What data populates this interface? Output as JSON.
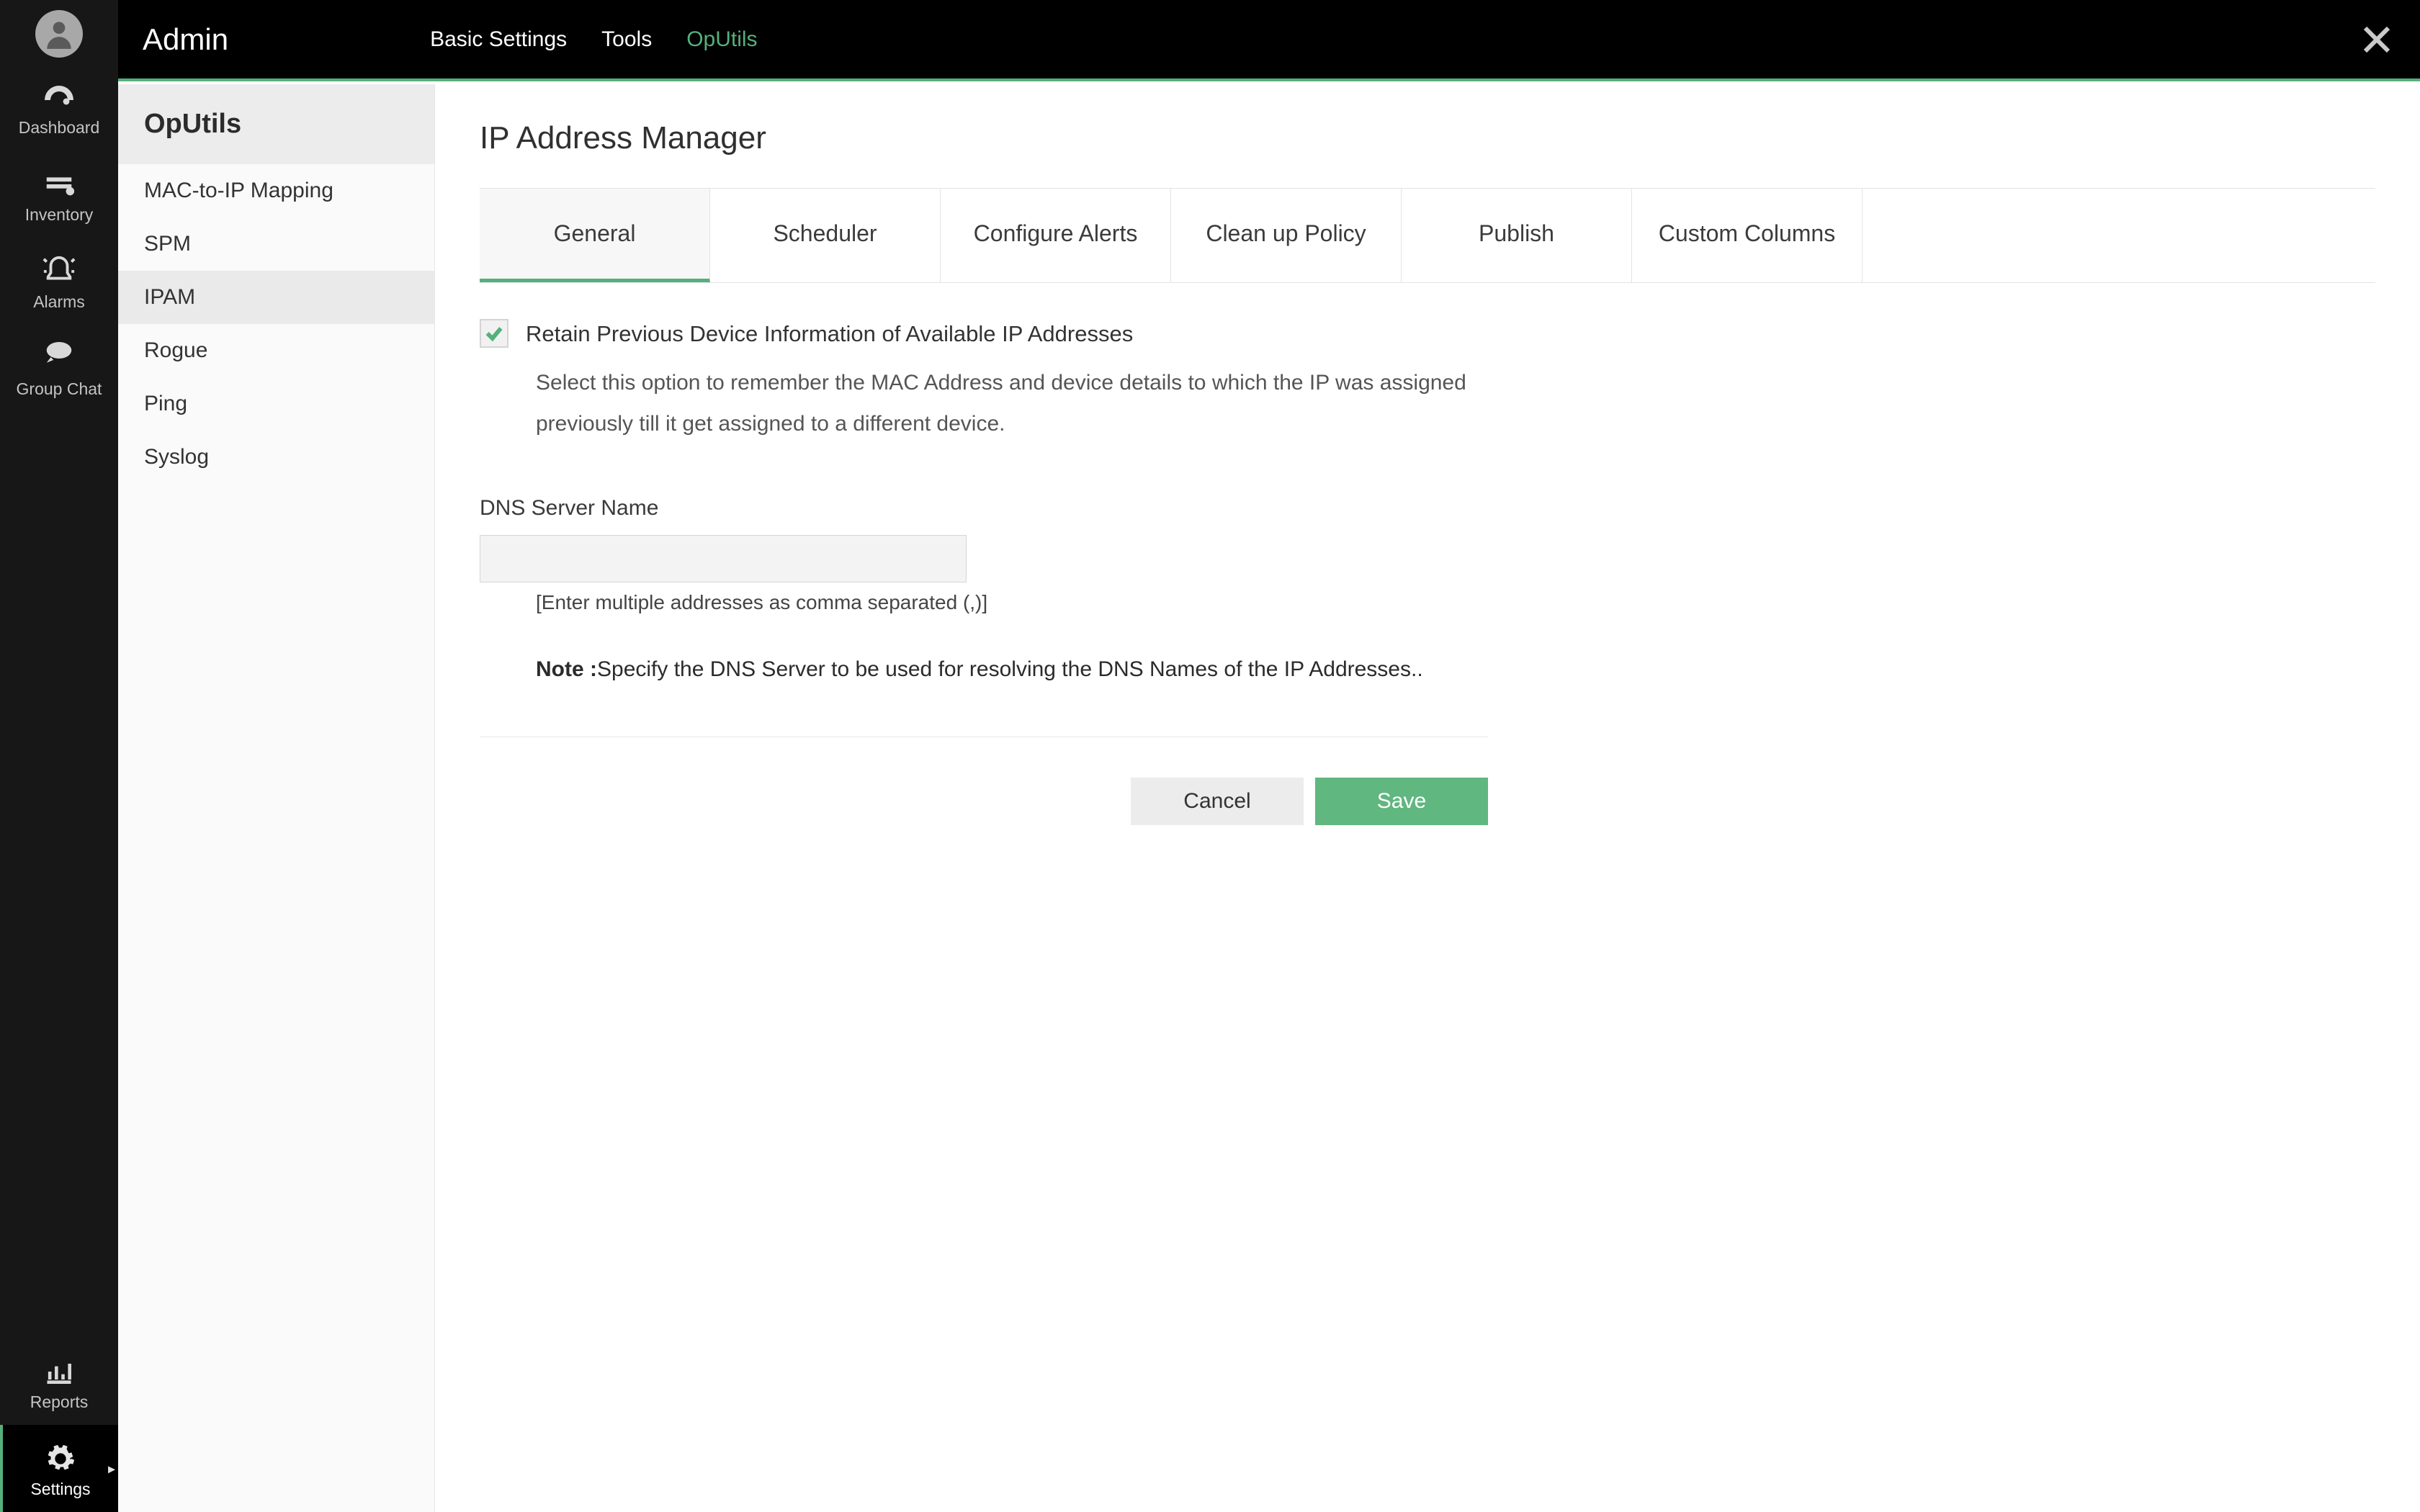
{
  "colors": {
    "accent": "#55b07c"
  },
  "nav_rail": {
    "items": [
      {
        "label": "Dashboard"
      },
      {
        "label": "Inventory"
      },
      {
        "label": "Alarms"
      },
      {
        "label": "Group Chat"
      }
    ],
    "bottom_items": [
      {
        "label": "Reports"
      },
      {
        "label": "Settings",
        "active": true
      }
    ]
  },
  "header": {
    "title": "Admin",
    "tabs": [
      {
        "label": "Basic Settings"
      },
      {
        "label": "Tools"
      },
      {
        "label": "OpUtils",
        "active": true
      }
    ]
  },
  "sidebar": {
    "title": "OpUtils",
    "items": [
      {
        "label": "MAC-to-IP Mapping"
      },
      {
        "label": "SPM"
      },
      {
        "label": "IPAM",
        "active": true
      },
      {
        "label": "Rogue"
      },
      {
        "label": "Ping"
      },
      {
        "label": "Syslog"
      }
    ]
  },
  "page": {
    "title": "IP Address Manager",
    "tabs": [
      {
        "label": "General",
        "active": true
      },
      {
        "label": "Scheduler"
      },
      {
        "label": "Configure Alerts"
      },
      {
        "label": "Clean up Policy"
      },
      {
        "label": "Publish"
      },
      {
        "label": "Custom Columns"
      }
    ],
    "retain_option": {
      "checked": true,
      "label": "Retain Previous Device Information of Available IP Addresses",
      "description": "Select this option to remember the MAC Address and device details to which the IP was assigned previously till it get assigned to a different device."
    },
    "dns": {
      "label": "DNS Server Name",
      "value": "",
      "hint": "[Enter multiple addresses as comma separated (,)]",
      "note_prefix": "Note :",
      "note_body": "Specify the DNS Server to be used for resolving the DNS Names of the IP Addresses.."
    },
    "buttons": {
      "cancel": "Cancel",
      "save": "Save"
    }
  }
}
